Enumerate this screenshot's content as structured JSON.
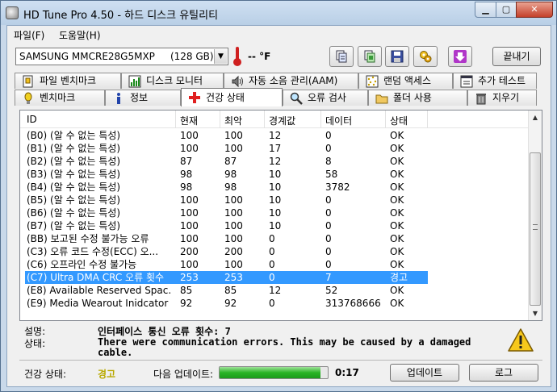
{
  "window": {
    "title": "HD Tune Pro 4.50 - 하드 디스크 유틸리티"
  },
  "menu": [
    {
      "label": "파일(F)"
    },
    {
      "label": "도움말(H)"
    }
  ],
  "toolbar": {
    "drive": "SAMSUNG MMCRE28G5MXP     (128 GB)",
    "temperature": "-- °F",
    "icons": [
      "copy-text-icon",
      "copy-screenshot-icon",
      "save-icon",
      "options-icon",
      "download-icon"
    ],
    "exit_label": "끝내기"
  },
  "tabs": {
    "top": [
      {
        "label": "파일 벤치마크",
        "icon": "file-benchmark-icon"
      },
      {
        "label": "디스크 모니터",
        "icon": "disk-monitor-icon"
      },
      {
        "label": "자동 소음 관리(AAM)",
        "icon": "speaker-icon"
      },
      {
        "label": "랜덤 액세스",
        "icon": "random-access-icon"
      },
      {
        "label": "추가 테스트",
        "icon": "extra-tests-icon"
      }
    ],
    "bottom": [
      {
        "label": "벤치마크",
        "icon": "benchmark-icon"
      },
      {
        "label": "정보",
        "icon": "info-icon"
      },
      {
        "label": "건강 상태",
        "icon": "health-cross-icon"
      },
      {
        "label": "오류 검사",
        "icon": "magnifier-icon"
      },
      {
        "label": "폴더 사용",
        "icon": "folder-icon"
      },
      {
        "label": "지우기",
        "icon": "trash-icon"
      }
    ],
    "active": "건강 상태"
  },
  "smart": {
    "columns": [
      "ID",
      "현재",
      "최악",
      "경계값",
      "데이터",
      "상태"
    ],
    "rows": [
      [
        "(B0) (알 수 없는 특성)",
        "100",
        "100",
        "12",
        "0",
        "OK"
      ],
      [
        "(B1) (알 수 없는 특성)",
        "100",
        "100",
        "17",
        "0",
        "OK"
      ],
      [
        "(B2) (알 수 없는 특성)",
        "87",
        "87",
        "12",
        "8",
        "OK"
      ],
      [
        "(B3) (알 수 없는 특성)",
        "98",
        "98",
        "10",
        "58",
        "OK"
      ],
      [
        "(B4) (알 수 없는 특성)",
        "98",
        "98",
        "10",
        "3782",
        "OK"
      ],
      [
        "(B5) (알 수 없는 특성)",
        "100",
        "100",
        "10",
        "0",
        "OK"
      ],
      [
        "(B6) (알 수 없는 특성)",
        "100",
        "100",
        "10",
        "0",
        "OK"
      ],
      [
        "(B7) (알 수 없는 특성)",
        "100",
        "100",
        "10",
        "0",
        "OK"
      ],
      [
        "(BB) 보고된 수정 불가능 오류",
        "100",
        "100",
        "0",
        "0",
        "OK"
      ],
      [
        "(C3) 오류 코드 수정(ECC) 오...",
        "200",
        "200",
        "0",
        "0",
        "OK"
      ],
      [
        "(C6) 오프라인 수정 불가능",
        "100",
        "100",
        "0",
        "0",
        "OK"
      ],
      [
        "(C7) Ultra DMA CRC 오류 횟수",
        "253",
        "253",
        "0",
        "7",
        "경고"
      ],
      [
        "(E8) Available Reserved Spac...",
        "85",
        "85",
        "12",
        "52",
        "OK"
      ],
      [
        "(E9) Media Wearout Inidcator ...",
        "92",
        "92",
        "0",
        "313768666",
        "OK"
      ]
    ],
    "selected_index": 11
  },
  "description": {
    "label1": "설명:",
    "text1": "인터페이스 통신 오류 횟수: 7",
    "label2": "상태:",
    "text2a": "There were communication errors. This may be caused by a damaged",
    "text2b": "cable."
  },
  "status": {
    "health_label": "건강 상태:",
    "health_value": "경고",
    "health_color": "#b8a800",
    "next_update_label": "다음 업데이트:",
    "progress_percent": 93,
    "countdown": "0:17",
    "update_button": "업데이트",
    "log_button": "로그"
  }
}
